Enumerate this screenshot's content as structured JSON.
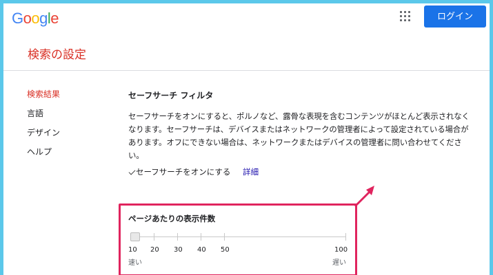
{
  "header": {
    "logo": [
      {
        "char": "G",
        "color": "#4285f4"
      },
      {
        "char": "o",
        "color": "#ea4335"
      },
      {
        "char": "o",
        "color": "#fbbc05"
      },
      {
        "char": "g",
        "color": "#4285f4"
      },
      {
        "char": "l",
        "color": "#34a853"
      },
      {
        "char": "e",
        "color": "#ea4335"
      }
    ],
    "login_label": "ログイン"
  },
  "page_title": "検索の設定",
  "sidebar": {
    "items": [
      {
        "label": "検索結果",
        "active": true
      },
      {
        "label": "言語",
        "active": false
      },
      {
        "label": "デザイン",
        "active": false
      },
      {
        "label": "ヘルプ",
        "active": false
      }
    ]
  },
  "safesearch": {
    "heading": "セーフサーチ フィルタ",
    "description_lines": [
      "セーフサーチをオンにすると、ポルノなど、露骨な表現を含むコンテンツがほとんど表示されなく",
      "なります。セーフサーチは、デバイスまたはネットワークの管理者によって設定されている場合が",
      "あります。オフにできない場合は、ネットワークまたはデバイスの管理者に問い合わせてくださ",
      "い。"
    ],
    "checkbox_label": "セーフサーチをオンにする",
    "checked": true,
    "details_link": "詳細"
  },
  "results_per_page": {
    "heading": "ページあたりの表示件数",
    "ticks": [
      "10",
      "20",
      "30",
      "40",
      "50",
      "100"
    ],
    "selected": "10",
    "slow_label": "速い",
    "fast_label": "遅い"
  },
  "colors": {
    "accent_red": "#d93025",
    "login_blue": "#1a73e8",
    "highlight": "#e0245e",
    "link": "#1a0dab"
  }
}
